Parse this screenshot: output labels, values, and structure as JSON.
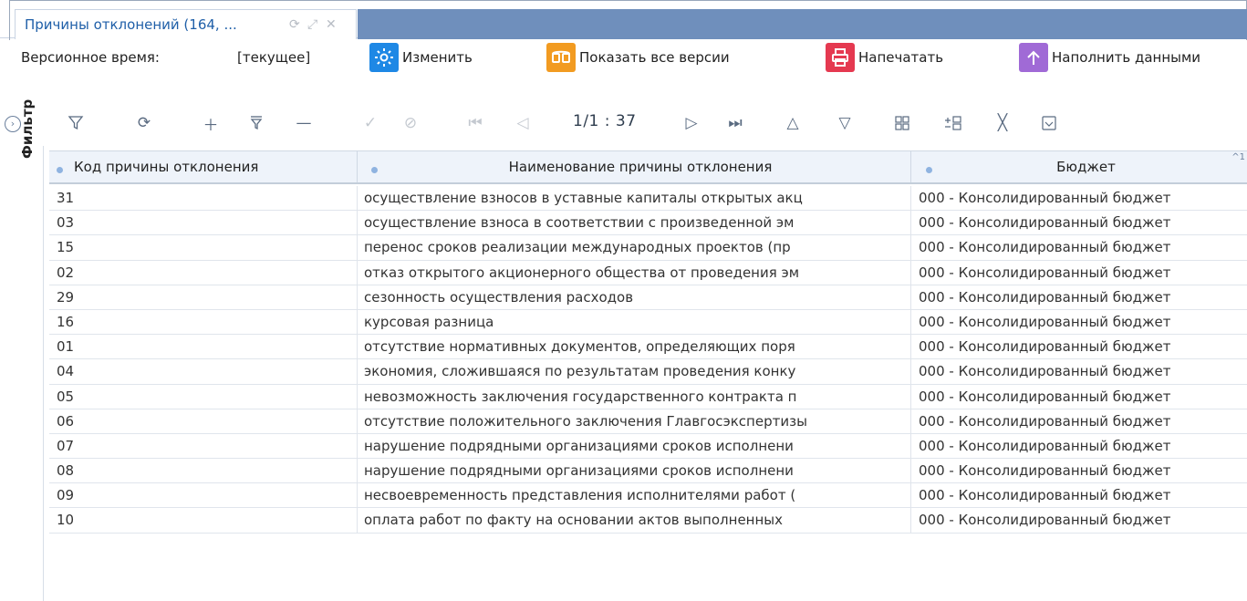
{
  "tab": {
    "title": "Причины отклонений (164, ...",
    "icons": [
      "refresh-icon",
      "expand-icon",
      "close-icon"
    ]
  },
  "version": {
    "label": "Версионное время:",
    "value": "[текущее]"
  },
  "actions": {
    "edit": "Изменить",
    "show_versions": "Показать все версии",
    "print": "Напечатать",
    "fill": "Наполнить данными"
  },
  "toolbar": {
    "page_info": "1/1 : 37"
  },
  "sidebar": {
    "filter_label": "Фильтр"
  },
  "grid": {
    "columns": [
      "Код причины отклонения",
      "Наименование причины отклонения",
      "Бюджет"
    ],
    "rows": [
      [
        "31",
        "осуществление взносов в уставные капиталы открытых акц",
        "000 - Консолидированный бюджет"
      ],
      [
        "03",
        "осуществление взноса в соответствии с произведенной эм",
        "000 - Консолидированный бюджет"
      ],
      [
        "15",
        "перенос сроков реализации международных проектов (пр",
        "000 - Консолидированный бюджет"
      ],
      [
        "02",
        "отказ открытого акционерного общества от проведения эм",
        "000 - Консолидированный бюджет"
      ],
      [
        "29",
        "сезонность осуществления расходов",
        "000 - Консолидированный бюджет"
      ],
      [
        "16",
        "курсовая разница",
        "000 - Консолидированный бюджет"
      ],
      [
        "01",
        "отсутствие нормативных документов, определяющих поря",
        "000 - Консолидированный бюджет"
      ],
      [
        "04",
        "экономия, сложившаяся по результатам проведения конку",
        "000 - Консолидированный бюджет"
      ],
      [
        "05",
        "невозможность заключения государственного контракта п",
        "000 - Консолидированный бюджет"
      ],
      [
        "06",
        "отсутствие положительного заключения Главгосэкспертизы",
        "000 - Консолидированный бюджет"
      ],
      [
        "07",
        "нарушение подрядными организациями сроков исполнени",
        "000 - Консолидированный бюджет"
      ],
      [
        "08",
        "нарушение подрядными организациями сроков исполнени",
        "000 - Консолидированный бюджет"
      ],
      [
        "09",
        "несвоевременность представления исполнителями работ (",
        "000 - Консолидированный бюджет"
      ],
      [
        "10",
        "оплата работ по факту на основании актов выполненных",
        "000 - Консолидированный бюджет"
      ]
    ]
  },
  "colors": {
    "tab_band": "#6f8fbc",
    "title_blue": "#1f5fa8",
    "header_bg": "#eef3fa",
    "edit_icon": "#1e88e5",
    "versions_icon": "#f29b21",
    "print_icon": "#e53950",
    "fill_icon": "#a06ad6"
  }
}
